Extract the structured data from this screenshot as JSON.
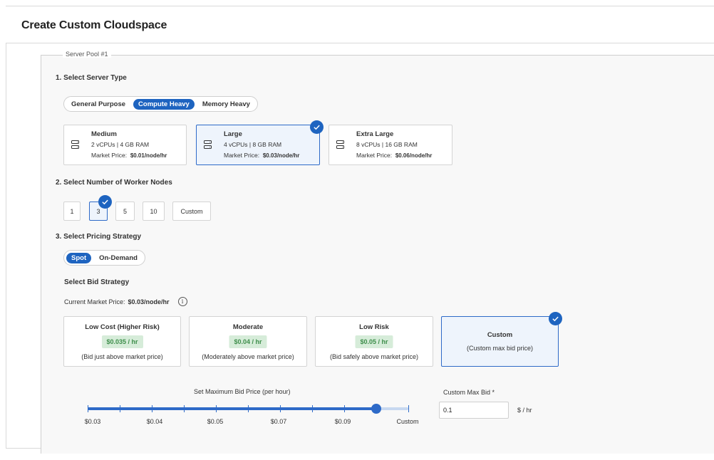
{
  "page_title": "Create Custom Cloudspace",
  "pool_legend": "Server Pool #1",
  "server_type": {
    "title": "1. Select Server Type",
    "categories": [
      "General Purpose",
      "Compute Heavy",
      "Memory Heavy"
    ],
    "active_category": "Compute Heavy",
    "cards": [
      {
        "name": "Medium",
        "spec": "2 vCPUs | 4 GB RAM",
        "price_label": "Market Price:",
        "price": "$0.01/node/hr",
        "selected": false
      },
      {
        "name": "Large",
        "spec": "4 vCPUs | 8 GB RAM",
        "price_label": "Market Price:",
        "price": "$0.03/node/hr",
        "selected": true
      },
      {
        "name": "Extra Large",
        "spec": "8 vCPUs | 16 GB RAM",
        "price_label": "Market Price:",
        "price": "$0.06/node/hr",
        "selected": false
      }
    ]
  },
  "worker_nodes": {
    "title": "2. Select Number of Worker Nodes",
    "options": [
      "1",
      "3",
      "5",
      "10",
      "Custom"
    ],
    "selected": "3"
  },
  "pricing": {
    "title": "3. Select Pricing Strategy",
    "options": [
      "Spot",
      "On-Demand"
    ],
    "active": "Spot"
  },
  "bid_strategy": {
    "title": "Select Bid Strategy",
    "market_label": "Current Market Price:",
    "market_price": "$0.03/node/hr",
    "info_icon": "i",
    "cards": [
      {
        "name": "Low Cost (Higher Risk)",
        "price": "$0.035 / hr",
        "desc": "(Bid just above market price)",
        "selected": false
      },
      {
        "name": "Moderate",
        "price": "$0.04 / hr",
        "desc": "(Moderately above market price)",
        "selected": false
      },
      {
        "name": "Low Risk",
        "price": "$0.05 / hr",
        "desc": "(Bid safely above market price)",
        "selected": false
      },
      {
        "name": "Custom",
        "price": "",
        "desc": "(Custom max bid price)",
        "selected": true
      }
    ]
  },
  "slider": {
    "label": "Set Maximum Bid Price (per hour)",
    "tick_labels": [
      "$0.03",
      "$0.04",
      "$0.05",
      "$0.07",
      "$0.09",
      "Custom"
    ],
    "value_fraction": 0.9
  },
  "custom_max_bid": {
    "label": "Custom Max Bid *",
    "value": "0.1",
    "unit": "$ / hr"
  },
  "colors": {
    "accent": "#1e64c0",
    "selected_bg": "#eef4fc",
    "price_badge_bg": "#d6ecd9",
    "price_badge_text": "#3e8e4b"
  }
}
